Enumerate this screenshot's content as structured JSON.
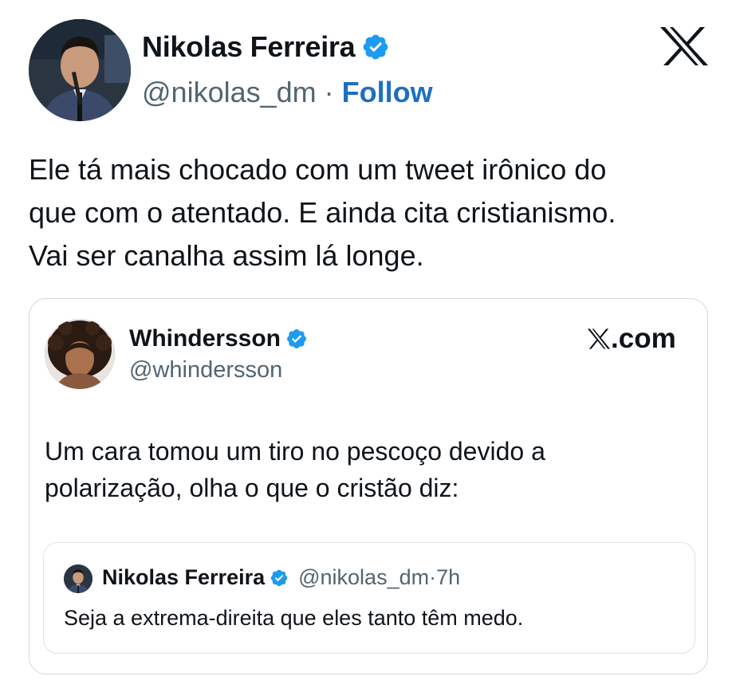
{
  "author": {
    "name": "Nikolas Ferreira",
    "handle": "@nikolas_dm",
    "separator": "·",
    "follow_label": "Follow",
    "verified_icon": "verified-badge-icon"
  },
  "platform_logo": "x-logo-icon",
  "tweet": {
    "lines": [
      "Ele tá mais chocado com um tweet irônico do",
      "que com o atentado. E ainda cita cristianismo.",
      "Vai ser canalha assim lá longe."
    ]
  },
  "card": {
    "author_name": "Whindersson",
    "author_handle": "@whindersson",
    "source_label": "X.com",
    "text_lines": [
      "Um cara tomou um tiro no pescoço devido a",
      "polarização, olha o que o cristão diz:"
    ],
    "quote": {
      "author_name": "Nikolas Ferreira",
      "author_handle": "@nikolas_dm",
      "separator": "·",
      "time": "7h",
      "text": "Seja a extrema-direita que eles tanto têm medo."
    }
  },
  "colors": {
    "text": "#0f1419",
    "secondary": "#536471",
    "follow": "#1d6fc0",
    "verified": "#1d9bf0",
    "border": "#cfd9de"
  }
}
